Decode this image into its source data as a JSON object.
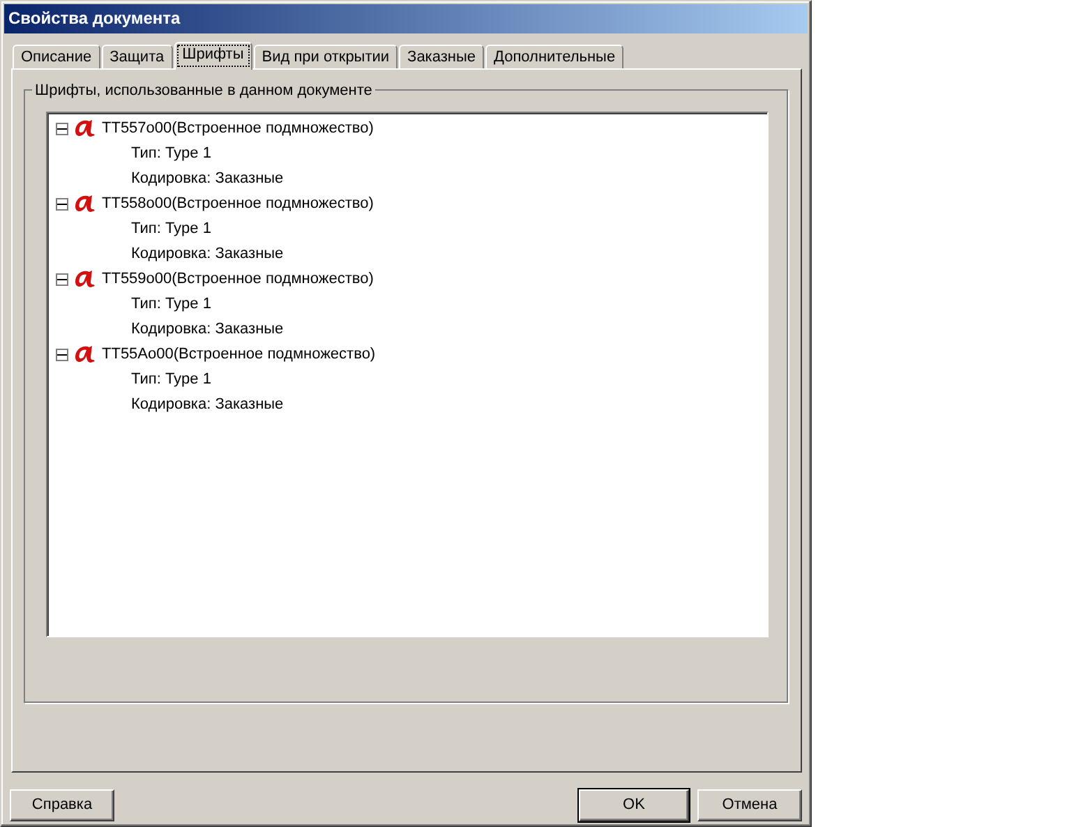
{
  "window": {
    "title": "Свойства документа"
  },
  "tabs": [
    {
      "label": "Описание",
      "selected": false
    },
    {
      "label": "Защита",
      "selected": false
    },
    {
      "label": "Шрифты",
      "selected": true
    },
    {
      "label": "Вид при открытии",
      "selected": false
    },
    {
      "label": "Заказные",
      "selected": false
    },
    {
      "label": "Дополнительные",
      "selected": false
    }
  ],
  "group": {
    "title": "Шрифты, использованные в данном документе"
  },
  "tree": [
    {
      "label": "TT557o00(Встроенное подмножество)",
      "expanded": true,
      "children": [
        {
          "label": "Тип: Type 1"
        },
        {
          "label": "Кодировка: Заказные"
        }
      ]
    },
    {
      "label": "TT558o00(Встроенное подмножество)",
      "expanded": true,
      "children": [
        {
          "label": "Тип: Type 1"
        },
        {
          "label": "Кодировка: Заказные"
        }
      ]
    },
    {
      "label": "TT559o00(Встроенное подмножество)",
      "expanded": true,
      "children": [
        {
          "label": "Тип: Type 1"
        },
        {
          "label": "Кодировка: Заказные"
        }
      ]
    },
    {
      "label": "TT55Ao00(Встроенное подмножество)",
      "expanded": true,
      "children": [
        {
          "label": "Тип: Type 1"
        },
        {
          "label": "Кодировка: Заказные"
        }
      ]
    }
  ],
  "help_button": {
    "label": "Справка"
  },
  "buttons": [
    {
      "label": "OK",
      "default": true
    },
    {
      "label": "Отмена",
      "default": false
    }
  ]
}
